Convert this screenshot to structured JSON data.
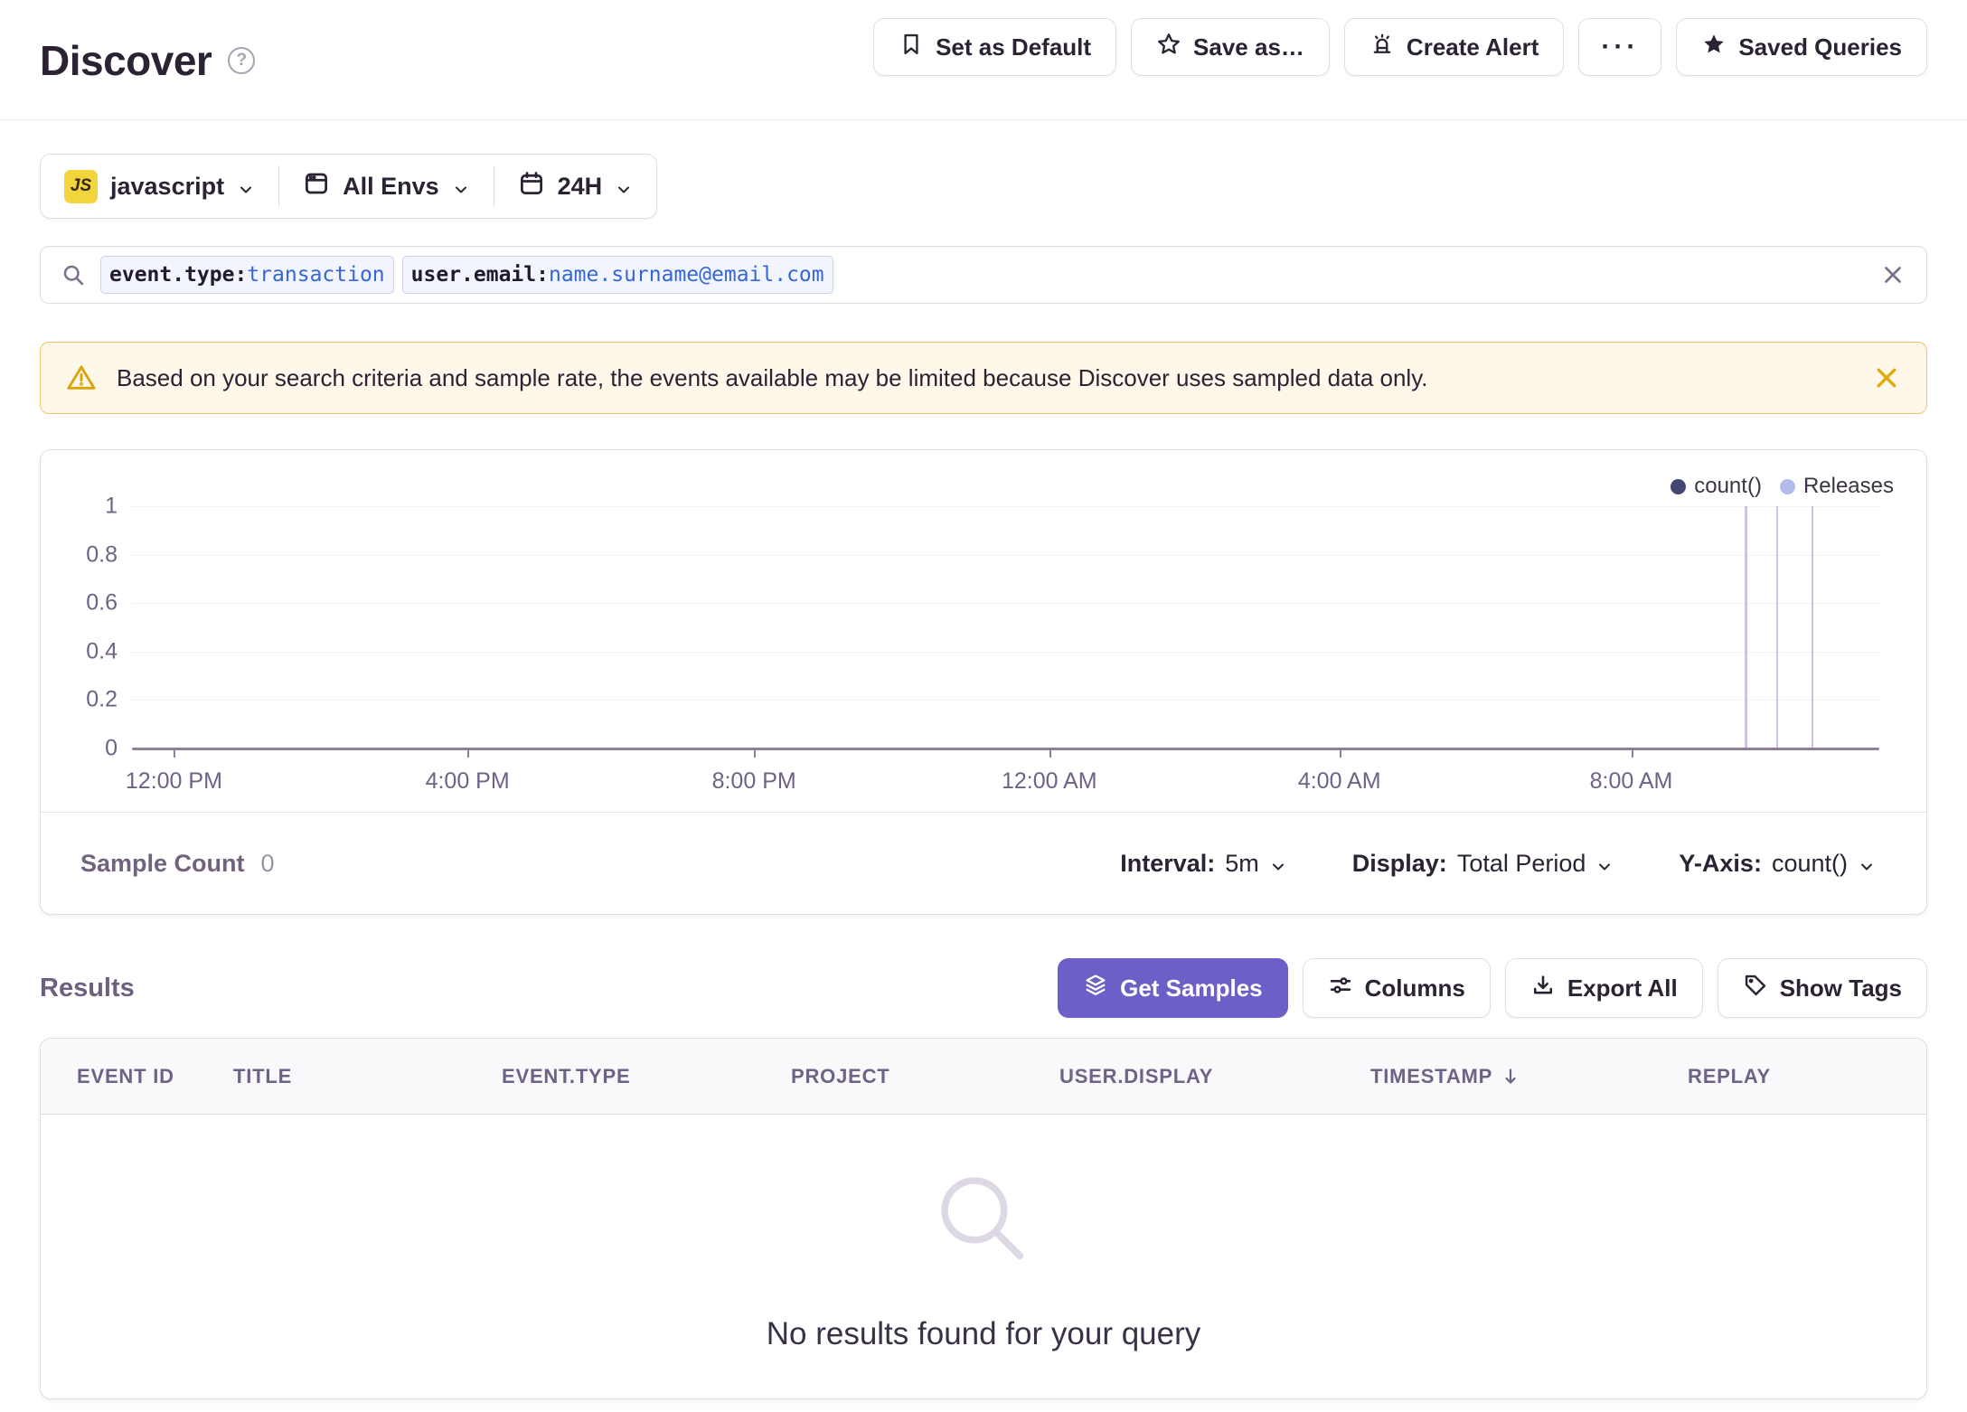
{
  "header": {
    "title": "Discover",
    "help_icon": "?",
    "actions": {
      "set_default": "Set as Default",
      "save_as": "Save as…",
      "create_alert": "Create Alert",
      "more": "···",
      "saved_queries": "Saved Queries"
    }
  },
  "filters": {
    "project": {
      "badge": "JS",
      "label": "javascript"
    },
    "environment": {
      "label": "All Envs"
    },
    "time_range": {
      "label": "24H"
    }
  },
  "search": {
    "tokens": [
      {
        "key": "event.type:",
        "value": "transaction"
      },
      {
        "key": "user.email:",
        "value": "name.surname@email.com"
      }
    ]
  },
  "banner": {
    "text": "Based on your search criteria and sample rate, the events available may be limited because Discover uses sampled data only."
  },
  "chart": {
    "legend": [
      {
        "label": "count()",
        "color": "#444674"
      },
      {
        "label": "Releases",
        "color": "#b5baed"
      }
    ],
    "yticks": [
      "1",
      "0.8",
      "0.6",
      "0.4",
      "0.2",
      "0"
    ],
    "xticks": [
      "12:00 PM",
      "4:00 PM",
      "8:00 PM",
      "12:00 AM",
      "4:00 AM",
      "8:00 AM"
    ],
    "footer": {
      "sample_count_label": "Sample Count",
      "sample_count_value": "0",
      "interval_label": "Interval:",
      "interval_value": "5m",
      "display_label": "Display:",
      "display_value": "Total Period",
      "yaxis_label": "Y-Axis:",
      "yaxis_value": "count()"
    }
  },
  "chart_data": {
    "type": "line",
    "series": [
      {
        "name": "count()",
        "values": []
      }
    ],
    "x_tick_labels": [
      "12:00 PM",
      "4:00 PM",
      "8:00 PM",
      "12:00 AM",
      "4:00 AM",
      "8:00 AM"
    ],
    "y_tick_labels": [
      0,
      0.2,
      0.4,
      0.6,
      0.8,
      1
    ],
    "ylim": [
      0,
      1
    ],
    "grid": true,
    "legend": [
      "count()",
      "Releases"
    ],
    "legend_position": "top-right",
    "release_marker_positions_pct": [
      92.3,
      94.1,
      96.1
    ],
    "sample_count": 0
  },
  "results": {
    "heading": "Results",
    "buttons": {
      "get_samples": "Get Samples",
      "columns": "Columns",
      "export_all": "Export All",
      "show_tags": "Show Tags"
    },
    "table": {
      "columns": [
        "Event ID",
        "Title",
        "Event.Type",
        "Project",
        "User.Display",
        "Timestamp",
        "Replay"
      ],
      "empty_message": "No results found for your query"
    }
  },
  "colors": {
    "accent_purple": "#6c5fc7",
    "count_series": "#444674",
    "releases": "#b5baed",
    "warning_bg": "#fdf8e9",
    "warning_border": "#eec76c",
    "warning_icon": "#d9a406",
    "js_badge": "#f2d43c"
  }
}
